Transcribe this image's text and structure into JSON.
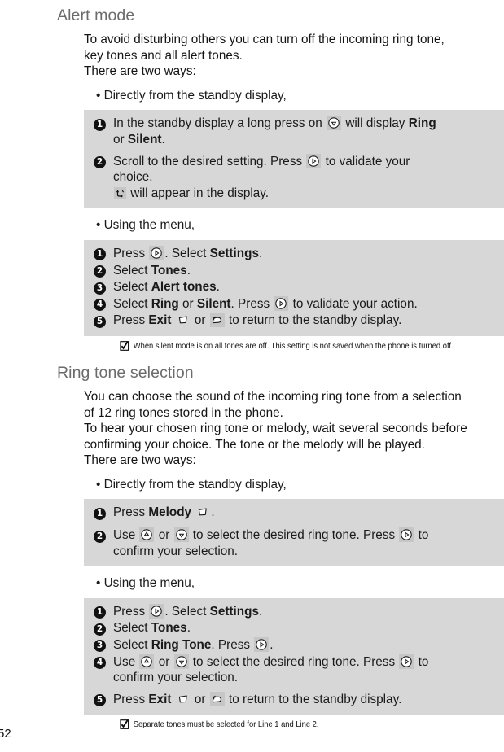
{
  "page": {
    "number": "52"
  },
  "sections": [
    {
      "heading": "Alert mode",
      "intro_lines": [
        "To avoid disturbing others you can turn off the incoming ring tone,",
        "key tones and all alert tones.",
        "There are two ways:"
      ],
      "bullet1": "• Directly from the standby display,",
      "bullet2": "• Using the menu,"
    },
    {
      "heading": "Ring tone selection",
      "intro_lines": [
        "You can choose the sound of the incoming ring tone from a selection",
        "of 12 ring tones stored in the phone.",
        "To hear your chosen ring tone or melody, wait several seconds before",
        "confirming your choice. The tone or the melody will be played.",
        "There are two ways:"
      ],
      "bullet1": "• Directly from the standby display,",
      "bullet2": "• Using the menu,"
    }
  ],
  "box1": {
    "steps": [
      {
        "num": "1",
        "line1_a": "In the standby display a long press on ",
        "icon1": "nav-down-key-icon",
        "line1_b": " will display ",
        "bold1": "Ring",
        "line2_a": "or ",
        "bold2": "Silent",
        "line2_b": "."
      },
      {
        "num": "2",
        "line1_a": "Scroll to the desired setting. Press ",
        "icon1": "nav-right-key-icon",
        "line1_b": " to validate your",
        "line2": "choice.",
        "icon2": "vibrate-indicator-icon",
        "line3": " will appear in the display."
      }
    ]
  },
  "box2": {
    "steps": [
      {
        "num": "1",
        "pre": "Press ",
        "icon": "nav-right-key-icon",
        "mid": ". Select ",
        "bold": "Settings",
        "post": "."
      },
      {
        "num": "2",
        "pre": "Select ",
        "bold": "Tones",
        "post": "."
      },
      {
        "num": "3",
        "pre": "Select ",
        "bold": "Alert tones",
        "post": "."
      },
      {
        "num": "4",
        "pre": "Select ",
        "bold": "Ring",
        "mid": " or ",
        "bold2": "Silent",
        "mid2": ". Press ",
        "icon": "nav-right-key-icon",
        "post": " to validate your action."
      },
      {
        "num": "5",
        "pre": "Press ",
        "bold": "Exit",
        "icon1": "softkey-icon",
        "mid": " or ",
        "icon2": "hangup-key-icon",
        "post": " to return to the standby display."
      }
    ]
  },
  "box3": {
    "steps": [
      {
        "num": "1",
        "pre": "Press ",
        "bold": "Melody",
        "icon": "softkey-icon",
        "post": "."
      },
      {
        "num": "2",
        "pre": "Use ",
        "icon1": "nav-up-key-icon",
        "mid": " or ",
        "icon2": "nav-down-key-icon",
        "post": " to select the desired ring tone. Press ",
        "icon3": "nav-right-key-icon",
        "tail": " to",
        "line2": "confirm your selection."
      }
    ]
  },
  "box4": {
    "steps": [
      {
        "num": "1",
        "pre": "Press ",
        "icon": "nav-right-key-icon",
        "mid": ". Select ",
        "bold": "Settings",
        "post": "."
      },
      {
        "num": "2",
        "pre": "Select ",
        "bold": "Tones",
        "post": "."
      },
      {
        "num": "3",
        "pre": "Select ",
        "bold": "Ring Tone",
        "mid": ". Press ",
        "icon": "nav-right-key-icon",
        "post": "."
      },
      {
        "num": "4",
        "pre": "Use ",
        "icon1": "nav-up-key-icon",
        "mid": " or ",
        "icon2": "nav-down-key-icon",
        "post": " to select the desired ring tone. Press ",
        "icon3": "nav-right-key-icon",
        "tail": " to",
        "line2": "confirm your selection."
      },
      {
        "num": "5",
        "pre": "Press ",
        "bold": "Exit",
        "icon1": "softkey-icon",
        "mid": " or ",
        "icon2": "hangup-key-icon",
        "post": " to return to the standby display."
      }
    ]
  },
  "footnotes": {
    "note1": "When silent mode is on all tones are off. This setting is not saved when the phone is turned off.",
    "note2": "Separate tones must be selected for Line 1 and Line 2.",
    "icon": "checkbox-checked-icon"
  },
  "colors": {
    "box_background": "#d7d7d7",
    "heading": "#6b6b6b",
    "text": "#141414",
    "icon_background": "#c6c6c6"
  }
}
